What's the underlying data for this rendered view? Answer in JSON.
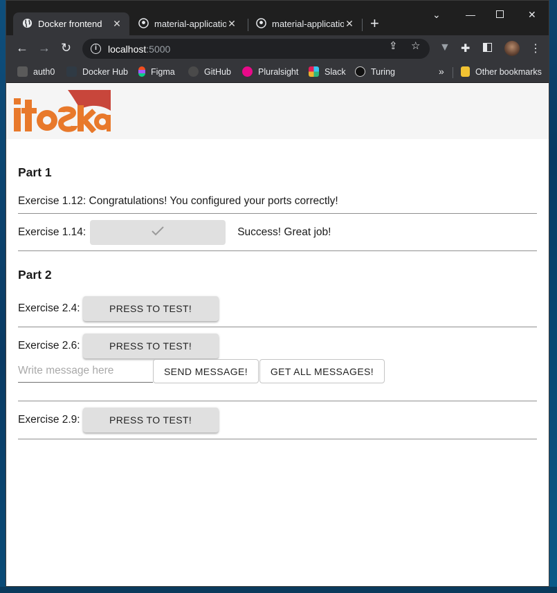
{
  "browser": {
    "tabs": [
      {
        "title": "Docker frontend",
        "active": true,
        "icon": "globe-icon"
      },
      {
        "title": "material-application",
        "active": false,
        "icon": "github-icon"
      },
      {
        "title": "material-application",
        "active": false,
        "icon": "github-icon"
      }
    ],
    "address": {
      "host": "localhost",
      "port": ":5000"
    },
    "bookmarks": [
      {
        "label": "auth0",
        "icon": "auth0-icon",
        "color": "#5a5a5a"
      },
      {
        "label": "Docker Hub",
        "icon": "docker-icon",
        "color": "#2f3a44"
      },
      {
        "label": "Figma",
        "icon": "figma-icon",
        "color": "#f24e1e"
      },
      {
        "label": "GitHub",
        "icon": "github-icon",
        "color": "#4a4a4a"
      },
      {
        "label": "Pluralsight",
        "icon": "pluralsight-icon",
        "color": "#e80a89"
      },
      {
        "label": "Slack",
        "icon": "slack-icon",
        "color": "#36c5f0"
      },
      {
        "label": "Turing",
        "icon": "turing-icon",
        "color": "#111111"
      }
    ],
    "other_bookmarks": "Other bookmarks"
  },
  "page": {
    "logo_text": "itoska",
    "part1": {
      "heading": "Part 1",
      "ex_1_12": "Exercise 1.12: Congratulations! You configured your ports correctly!",
      "ex_1_14_label": "Exercise 1.14:",
      "ex_1_14_result": "Success! Great job!"
    },
    "part2": {
      "heading": "Part 2",
      "ex_2_4_label": "Exercise 2.4:",
      "ex_2_6_label": "Exercise 2.6:",
      "ex_2_9_label": "Exercise 2.9:",
      "press_to_test": "PRESS TO TEST!",
      "message_placeholder": "Write message here",
      "send_message": "SEND MESSAGE!",
      "get_all_messages": "GET ALL MESSAGES!"
    }
  },
  "colors": {
    "logo_orange": "#e8792b",
    "logo_red": "#c8463b",
    "button_grey": "#e0e0e0"
  }
}
